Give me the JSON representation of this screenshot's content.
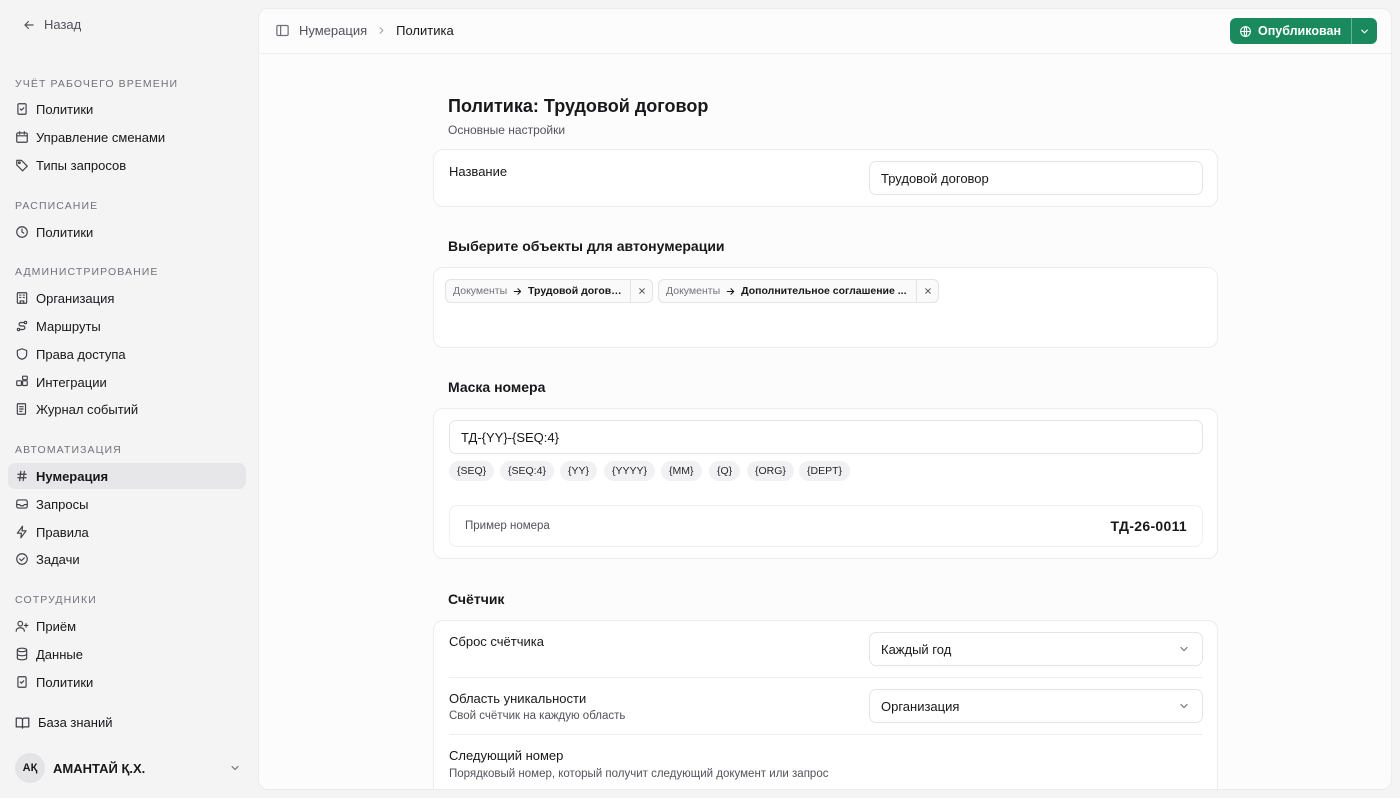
{
  "sidebar": {
    "back_label": "Назад",
    "sections": [
      {
        "title": "УЧЁТ РАБОЧЕГО ВРЕМЕНИ",
        "items": [
          {
            "label": "Политики",
            "icon": "document-check-icon"
          },
          {
            "label": "Управление сменами",
            "icon": "calendar-clock-icon"
          },
          {
            "label": "Типы запросов",
            "icon": "tag-icon"
          }
        ]
      },
      {
        "title": "РАСПИСАНИЕ",
        "items": [
          {
            "label": "Политики",
            "icon": "clock-icon"
          }
        ]
      },
      {
        "title": "АДМИНИСТРИРОВАНИЕ",
        "items": [
          {
            "label": "Организация",
            "icon": "building-icon"
          },
          {
            "label": "Маршруты",
            "icon": "route-icon"
          },
          {
            "label": "Права доступа",
            "icon": "shield-icon"
          },
          {
            "label": "Интеграции",
            "icon": "puzzle-icon"
          },
          {
            "label": "Журнал событий",
            "icon": "log-icon"
          }
        ]
      },
      {
        "title": "АВТОМАТИЗАЦИЯ",
        "items": [
          {
            "label": "Нумерация",
            "icon": "hash-icon",
            "active": true
          },
          {
            "label": "Запросы",
            "icon": "inbox-icon"
          },
          {
            "label": "Правила",
            "icon": "bolt-icon"
          },
          {
            "label": "Задачи",
            "icon": "check-circle-icon"
          }
        ]
      },
      {
        "title": "СОТРУДНИКИ",
        "items": [
          {
            "label": "Приём",
            "icon": "user-plus-icon"
          },
          {
            "label": "Данные",
            "icon": "database-icon"
          },
          {
            "label": "Политики",
            "icon": "document-check-icon"
          }
        ]
      }
    ],
    "knowledge_base": "База знаний",
    "user": {
      "initials": "АҚ",
      "name": "АМАНТАЙ Қ.Х."
    }
  },
  "header": {
    "breadcrumb": [
      "Нумерация",
      "Политика"
    ],
    "status_label": "Опубликован",
    "accent_color": "#1a8a5e"
  },
  "page": {
    "title": "Политика: Трудовой договор",
    "subtitle": "Основные настройки",
    "name_field": {
      "label": "Название",
      "value": "Трудовой договор"
    },
    "objects_title": "Выберите объекты для автонумерации",
    "objects": [
      {
        "source": "Документы",
        "name": "Трудовой договор"
      },
      {
        "source": "Документы",
        "name": "Дополнительное соглашение ..."
      }
    ],
    "mask_title": "Маска номера",
    "mask_value": "ТД-{YY}-{SEQ:4}",
    "tokens": [
      "{SEQ}",
      "{SEQ:4}",
      "{YY}",
      "{YYYY}",
      "{MM}",
      "{Q}",
      "{ORG}",
      "{DEPT}"
    ],
    "preview_label": "Пример номера",
    "preview_value": "ТД-26-0011",
    "counter_title": "Счётчик",
    "reset_label": "Сброс счётчика",
    "reset_value": "Каждый год",
    "scope_label": "Область уникальности",
    "scope_hint": "Свой счётчик на каждую область",
    "scope_value": "Организация",
    "next_label": "Следующий номер",
    "next_hint": "Порядковый номер, который получит следующий документ или запрос"
  }
}
